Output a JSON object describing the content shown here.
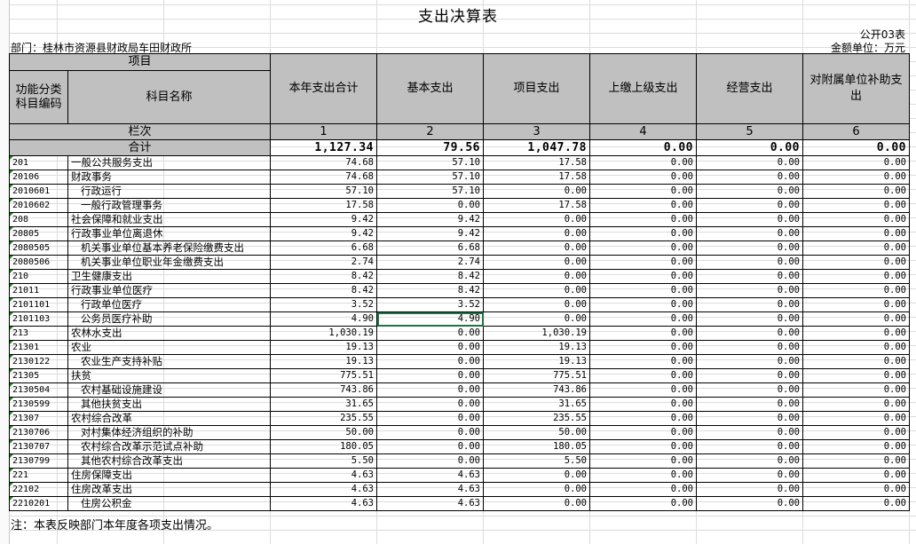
{
  "title": "支出决算表",
  "form_no": "公开03表",
  "department": "部门：桂林市资源县财政局车田财政所",
  "unit": "金额单位：万元",
  "header": {
    "item_group": "项目",
    "code_col": "功能分类科目编码",
    "name_col": "科目名称",
    "cols": [
      "本年支出合计",
      "基本支出",
      "项目支出",
      "上缴上级支出",
      "经营支出",
      "对附属单位补助支出"
    ],
    "row_label": "栏次",
    "col_numbers": [
      "1",
      "2",
      "3",
      "4",
      "5",
      "6"
    ]
  },
  "total": {
    "label": "合计",
    "values": [
      "1,127.34",
      "79.56",
      "1,047.78",
      "0.00",
      "0.00",
      "0.00"
    ]
  },
  "rows": [
    {
      "code": "201",
      "name": "一般公共服务支出",
      "level": 0,
      "values": [
        "74.68",
        "57.10",
        "17.58",
        "0.00",
        "0.00",
        "0.00"
      ]
    },
    {
      "code": "20106",
      "name": "财政事务",
      "level": 0,
      "values": [
        "74.68",
        "57.10",
        "17.58",
        "0.00",
        "0.00",
        "0.00"
      ]
    },
    {
      "code": "2010601",
      "name": "行政运行",
      "level": 1,
      "values": [
        "57.10",
        "57.10",
        "0.00",
        "0.00",
        "0.00",
        "0.00"
      ]
    },
    {
      "code": "2010602",
      "name": "一般行政管理事务",
      "level": 1,
      "values": [
        "17.58",
        "0.00",
        "17.58",
        "0.00",
        "0.00",
        "0.00"
      ]
    },
    {
      "code": "208",
      "name": "社会保障和就业支出",
      "level": 0,
      "values": [
        "9.42",
        "9.42",
        "0.00",
        "0.00",
        "0.00",
        "0.00"
      ]
    },
    {
      "code": "20805",
      "name": "行政事业单位离退休",
      "level": 0,
      "values": [
        "9.42",
        "9.42",
        "0.00",
        "0.00",
        "0.00",
        "0.00"
      ]
    },
    {
      "code": "2080505",
      "name": "机关事业单位基本养老保险缴费支出",
      "level": 1,
      "values": [
        "6.68",
        "6.68",
        "0.00",
        "0.00",
        "0.00",
        "0.00"
      ]
    },
    {
      "code": "2080506",
      "name": "机关事业单位职业年金缴费支出",
      "level": 1,
      "values": [
        "2.74",
        "2.74",
        "0.00",
        "0.00",
        "0.00",
        "0.00"
      ]
    },
    {
      "code": "210",
      "name": "卫生健康支出",
      "level": 0,
      "values": [
        "8.42",
        "8.42",
        "0.00",
        "0.00",
        "0.00",
        "0.00"
      ]
    },
    {
      "code": "21011",
      "name": "行政事业单位医疗",
      "level": 0,
      "values": [
        "8.42",
        "8.42",
        "0.00",
        "0.00",
        "0.00",
        "0.00"
      ]
    },
    {
      "code": "2101101",
      "name": "行政单位医疗",
      "level": 1,
      "values": [
        "3.52",
        "3.52",
        "0.00",
        "0.00",
        "0.00",
        "0.00"
      ]
    },
    {
      "code": "2101103",
      "name": "公务员医疗补助",
      "level": 1,
      "values": [
        "4.90",
        "4.90",
        "0.00",
        "0.00",
        "0.00",
        "0.00"
      ],
      "selected_col": 1
    },
    {
      "code": "213",
      "name": "农林水支出",
      "level": 0,
      "values": [
        "1,030.19",
        "0.00",
        "1,030.19",
        "0.00",
        "0.00",
        "0.00"
      ]
    },
    {
      "code": "21301",
      "name": "农业",
      "level": 0,
      "values": [
        "19.13",
        "0.00",
        "19.13",
        "0.00",
        "0.00",
        "0.00"
      ]
    },
    {
      "code": "2130122",
      "name": "农业生产支持补贴",
      "level": 1,
      "values": [
        "19.13",
        "0.00",
        "19.13",
        "0.00",
        "0.00",
        "0.00"
      ]
    },
    {
      "code": "21305",
      "name": "扶贫",
      "level": 0,
      "values": [
        "775.51",
        "0.00",
        "775.51",
        "0.00",
        "0.00",
        "0.00"
      ]
    },
    {
      "code": "2130504",
      "name": "农村基础设施建设",
      "level": 1,
      "values": [
        "743.86",
        "0.00",
        "743.86",
        "0.00",
        "0.00",
        "0.00"
      ]
    },
    {
      "code": "2130599",
      "name": "其他扶贫支出",
      "level": 1,
      "values": [
        "31.65",
        "0.00",
        "31.65",
        "0.00",
        "0.00",
        "0.00"
      ]
    },
    {
      "code": "21307",
      "name": "农村综合改革",
      "level": 0,
      "values": [
        "235.55",
        "0.00",
        "235.55",
        "0.00",
        "0.00",
        "0.00"
      ]
    },
    {
      "code": "2130706",
      "name": "对村集体经济组织的补助",
      "level": 1,
      "values": [
        "50.00",
        "0.00",
        "50.00",
        "0.00",
        "0.00",
        "0.00"
      ]
    },
    {
      "code": "2130707",
      "name": "农村综合改革示范试点补助",
      "level": 1,
      "values": [
        "180.05",
        "0.00",
        "180.05",
        "0.00",
        "0.00",
        "0.00"
      ]
    },
    {
      "code": "2130799",
      "name": "其他农村综合改革支出",
      "level": 1,
      "values": [
        "5.50",
        "0.00",
        "5.50",
        "0.00",
        "0.00",
        "0.00"
      ]
    },
    {
      "code": "221",
      "name": "住房保障支出",
      "level": 0,
      "values": [
        "4.63",
        "4.63",
        "0.00",
        "0.00",
        "0.00",
        "0.00"
      ]
    },
    {
      "code": "22102",
      "name": "住房改革支出",
      "level": 0,
      "values": [
        "4.63",
        "4.63",
        "0.00",
        "0.00",
        "0.00",
        "0.00"
      ]
    },
    {
      "code": "2210201",
      "name": "住房公积金",
      "level": 1,
      "values": [
        "4.63",
        "4.63",
        "0.00",
        "0.00",
        "0.00",
        "0.00"
      ]
    }
  ],
  "note": "注：本表反映部门本年度各项支出情况。"
}
